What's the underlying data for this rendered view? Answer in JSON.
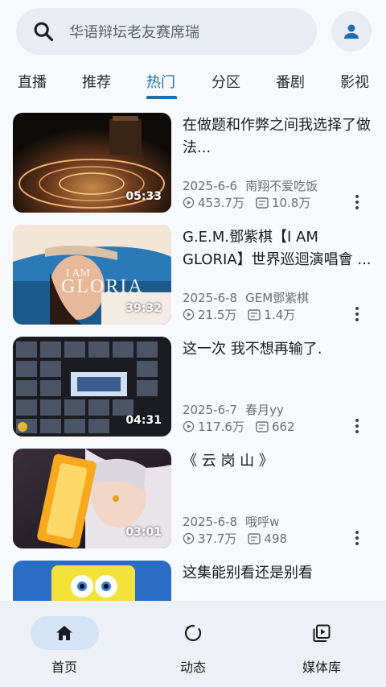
{
  "search": {
    "placeholder": "华语辩坛老友赛席瑞"
  },
  "tabs": [
    {
      "label": "直播"
    },
    {
      "label": "推荐"
    },
    {
      "label": "热门"
    },
    {
      "label": "分区"
    },
    {
      "label": "番剧"
    },
    {
      "label": "影视"
    }
  ],
  "active_tab": "热门",
  "videos": [
    {
      "title": "在做题和作弊之间我选择了做法...",
      "date": "2025-6-6",
      "author": "南翔不爱吃饭",
      "views": "453.7万",
      "danmaku": "10.8万",
      "duration": "05:33"
    },
    {
      "title": "G.E.M.鄧紫棋【I AM GLORIA】世界巡迴演唱會 ...",
      "date": "2025-6-8",
      "author": "GEM鄧紫棋",
      "views": "21.5万",
      "danmaku": "1.4万",
      "duration": "39:32"
    },
    {
      "title": "这一次 我不想再输了.",
      "date": "2025-6-7",
      "author": "春月yy",
      "views": "117.6万",
      "danmaku": "662",
      "duration": "04:31"
    },
    {
      "title": "《 云 岗 山 》",
      "date": "2025-6-8",
      "author": "哦呼w",
      "views": "37.7万",
      "danmaku": "498",
      "duration": "03:01"
    },
    {
      "title": "这集能别看还是别看"
    }
  ],
  "bottom_nav": [
    {
      "label": "首页",
      "icon": "home-icon"
    },
    {
      "label": "动态",
      "icon": "activity-icon"
    },
    {
      "label": "媒体库",
      "icon": "media-library-icon"
    }
  ],
  "colors": {
    "accent": "#1f6faa",
    "nav_pill": "#d4e4f6",
    "search_bg": "#e9ecf2"
  }
}
